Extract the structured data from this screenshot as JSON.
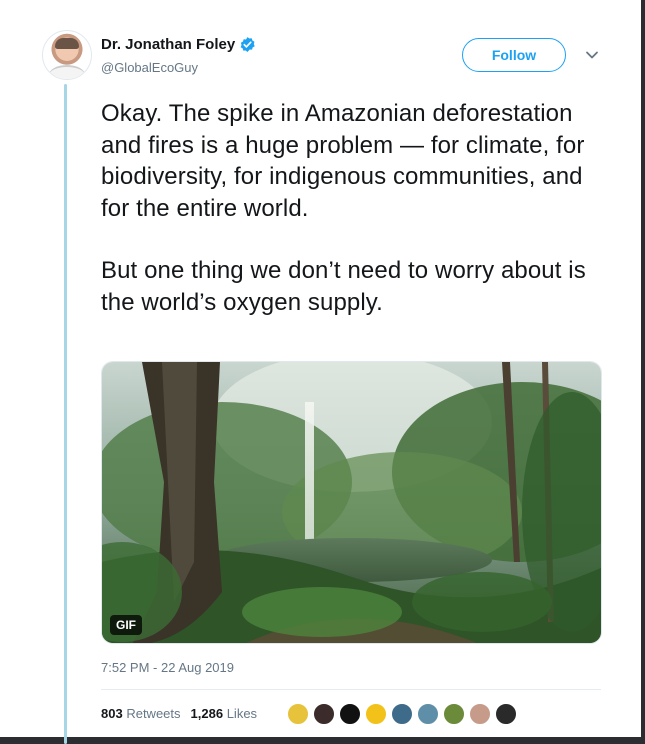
{
  "author": {
    "name": "Dr. Jonathan Foley",
    "handle": "@GlobalEcoGuy"
  },
  "actions": {
    "follow_label": "Follow"
  },
  "tweet": {
    "paragraph1": "Okay. The spike in Amazonian deforestation and fires is a huge problem — for climate, for biodiversity, for indigenous communities, and for the entire world.",
    "paragraph2": "But one thing we don’t need to worry about is the world’s oxygen supply.",
    "media_badge": "GIF",
    "timestamp": "7:52 PM - 22 Aug 2019"
  },
  "stats": {
    "retweets_count": "803",
    "retweets_label": "Retweets",
    "likes_count": "1,286",
    "likes_label": "Likes"
  },
  "colors": {
    "accent": "#1da1f2",
    "thread_line": "#a7d7e7",
    "muted_text": "#657786"
  },
  "liker_avatars": [
    {
      "color": "#e7c23b",
      "icon": "owl-avatar"
    },
    {
      "color": "#3b2b2b",
      "icon": "person-avatar"
    },
    {
      "color": "#111111",
      "icon": "sun-avatar"
    },
    {
      "color": "#f3c21a",
      "icon": "cross-avatar"
    },
    {
      "color": "#3f6b8a",
      "icon": "landscape-avatar"
    },
    {
      "color": "#5f8fa8",
      "icon": "sea-avatar"
    },
    {
      "color": "#6b8a3a",
      "icon": "plant-avatar"
    },
    {
      "color": "#c79b8a",
      "icon": "woman-avatar"
    },
    {
      "color": "#2a2a2a",
      "icon": "bw-avatar"
    }
  ]
}
